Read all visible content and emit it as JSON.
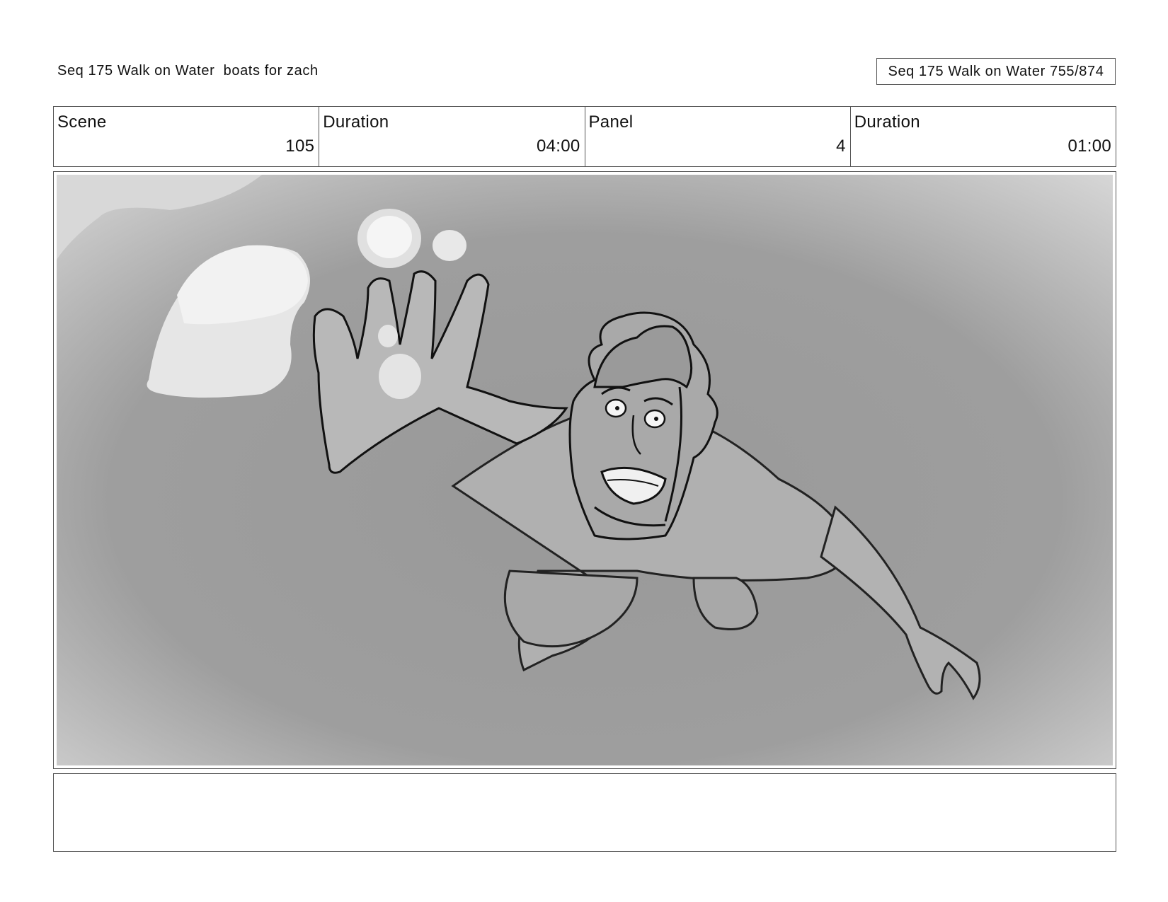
{
  "header": {
    "title": "Seq 175 Walk on Water  boats for zach",
    "page_counter": "Seq 175 Walk on Water 755/874"
  },
  "info": [
    {
      "label": "Scene",
      "value": "105"
    },
    {
      "label": "Duration",
      "value": "04:00"
    },
    {
      "label": "Panel",
      "value": "4"
    },
    {
      "label": "Duration",
      "value": "01:00"
    }
  ],
  "panel": {
    "description_icon": "storyboard-sketch-falling-man-icon",
    "colors": {
      "background_mid": "#9a9a9a",
      "background_light": "#dcdcdc",
      "cloud": "#e8e8e8",
      "figure": "#b4b4b4",
      "line": "#111111"
    }
  },
  "notes": {
    "text": ""
  }
}
